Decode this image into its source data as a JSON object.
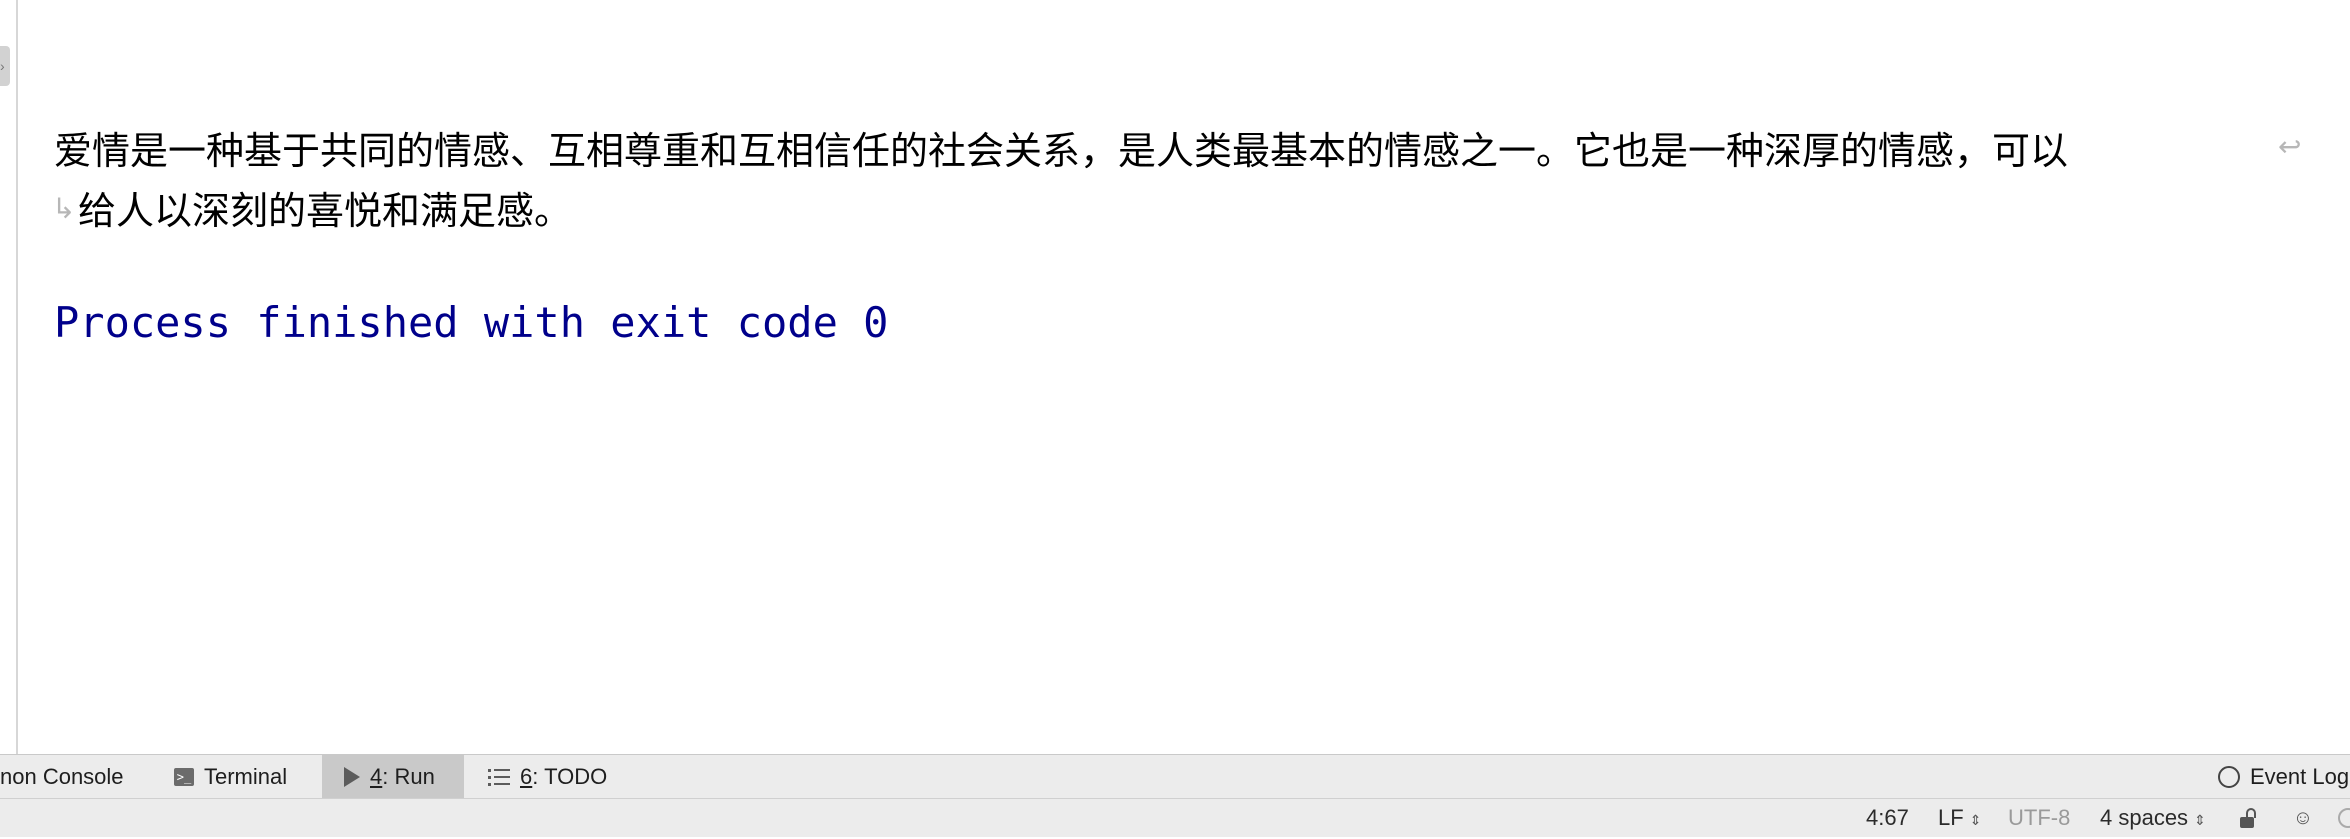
{
  "console": {
    "output_line_1": "爱情是一种基于共同的情感、互相尊重和互相信任的社会关系，是人类最基本的情感之一。它也是一种深厚的情感，可以",
    "output_line_2": "给人以深刻的喜悦和满足感。",
    "process_message": "Process finished with exit code 0"
  },
  "tool_windows": {
    "python_console": "non Console",
    "terminal": "Terminal",
    "run_number": "4",
    "run_label": ": Run",
    "todo_number": "6",
    "todo_label": ": TODO",
    "event_log": "Event Log"
  },
  "status_bar": {
    "position": "4:67",
    "line_separator": "LF",
    "encoding": "UTF-8",
    "indent": "4 spaces"
  },
  "colors": {
    "process_text": "#00008b",
    "active_tab": "#c9c9c9",
    "bar_background": "#ececec"
  }
}
